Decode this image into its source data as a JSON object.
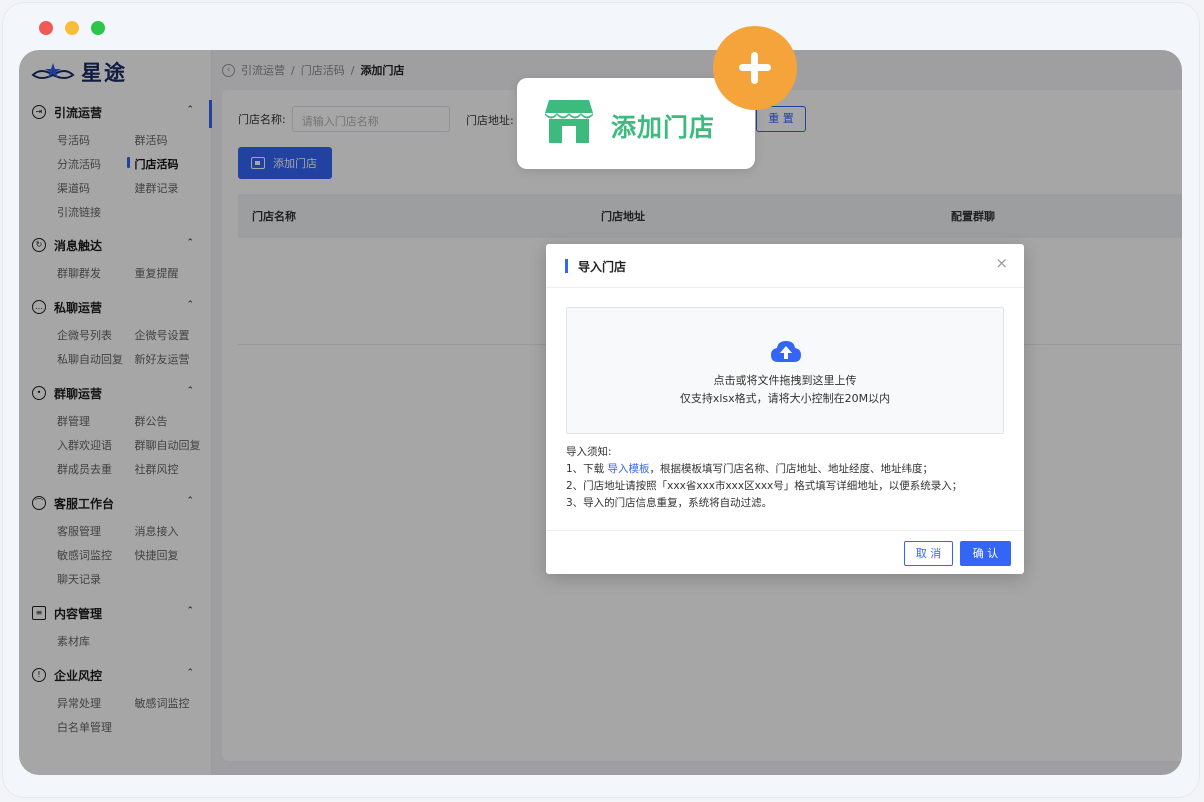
{
  "window": {
    "dot_colors": [
      "#f15b56",
      "#f8be3a",
      "#2dc54a"
    ]
  },
  "logo": {
    "text": "星途"
  },
  "breadcrumb": {
    "items": [
      "引流运营",
      "门店活码",
      "添加门店"
    ],
    "separator": "/"
  },
  "sidebar": {
    "sections": [
      {
        "title": "引流运营",
        "icon": "inbox-icon",
        "rows": [
          [
            "号活码",
            "群活码"
          ],
          [
            "分流活码",
            "门店活码"
          ],
          [
            "渠道码",
            "建群记录"
          ],
          [
            "引流链接"
          ]
        ],
        "active_item": "门店活码"
      },
      {
        "title": "消息触达",
        "icon": "refresh-icon",
        "rows": [
          [
            "群聊群发",
            "重复提醒"
          ]
        ]
      },
      {
        "title": "私聊运营",
        "icon": "chat-icon",
        "rows": [
          [
            "企微号列表",
            "企微号设置"
          ],
          [
            "私聊自动回复",
            "新好友运营"
          ]
        ]
      },
      {
        "title": "群聊运营",
        "icon": "group-icon",
        "rows": [
          [
            "群管理",
            "群公告"
          ],
          [
            "入群欢迎语",
            "群聊自动回复"
          ],
          [
            "群成员去重",
            "社群风控"
          ]
        ]
      },
      {
        "title": "客服工作台",
        "icon": "headset-icon",
        "rows": [
          [
            "客服管理",
            "消息接入"
          ],
          [
            "敏感词监控",
            "快捷回复"
          ],
          [
            "聊天记录"
          ]
        ]
      },
      {
        "title": "内容管理",
        "icon": "document-icon",
        "rows": [
          [
            "素材库"
          ]
        ]
      },
      {
        "title": "企业风控",
        "icon": "shield-icon",
        "rows": [
          [
            "异常处理",
            "敏感词监控"
          ],
          [
            "白名单管理"
          ]
        ]
      }
    ]
  },
  "filter": {
    "store_name_label": "门店名称:",
    "store_name_placeholder": "请输入门店名称",
    "store_address_label": "门店地址:",
    "reset_label": "重 置"
  },
  "toolbar": {
    "add_store_label": "添加门店"
  },
  "table": {
    "headers": [
      "门店名称",
      "门店地址",
      "配置群聊"
    ]
  },
  "modal": {
    "title": "导入门店",
    "close_glyph": "×",
    "upload_line1": "点击或将文件拖拽到这里上传",
    "upload_line2": "仅支持xlsx格式，请将大小控制在20M以内",
    "notes_title": "导入须知:",
    "note1_prefix": "1、下载 ",
    "note1_link": "导入模板",
    "note1_suffix": "，根据模板填写门店名称、门店地址、地址经度、地址纬度；",
    "note2": "2、门店地址请按照「xxx省xxx市xxx区xxx号」格式填写详细地址，以便系统录入；",
    "note3": "3、导入的门店信息重复，系统将自动过滤。",
    "cancel_label": "取 消",
    "confirm_label": "确 认"
  },
  "callout": {
    "text": "添加门店",
    "icon": "store-icon",
    "badge_icon": "plus-icon"
  },
  "colors": {
    "accent": "#3466f6",
    "callout_green": "#3dba7e",
    "badge_orange": "#f5a43b"
  }
}
